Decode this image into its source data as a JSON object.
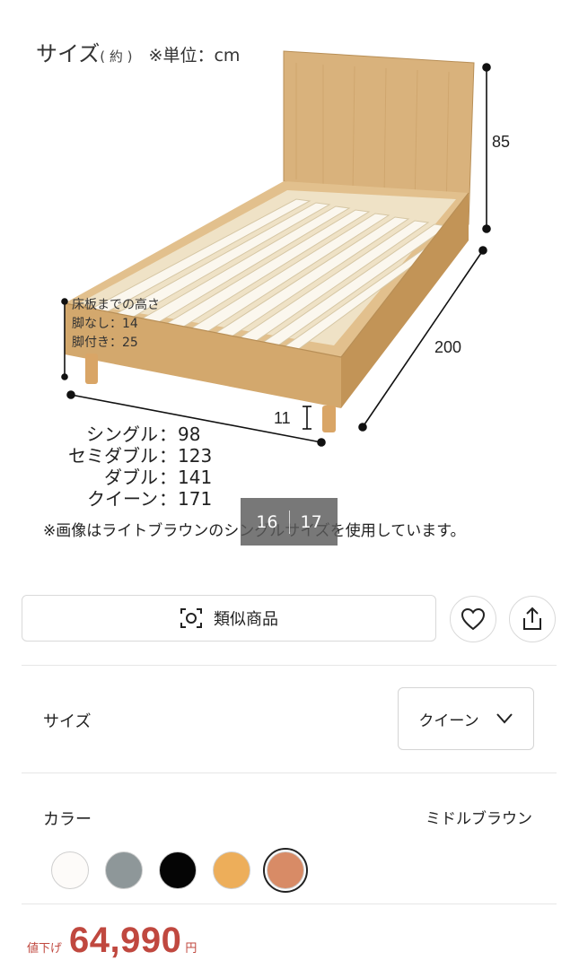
{
  "image": {
    "size_title": "サイズ",
    "size_title_approx": "( 約 )",
    "unit_note": "※単位：cm",
    "dimensions": {
      "headboard_height": "85",
      "length": "200",
      "leg_height": "11"
    },
    "height_note": {
      "title": "床板までの高さ",
      "no_legs": "脚なし：14",
      "with_legs": "脚付き：25"
    },
    "widths": [
      {
        "name": "シングル",
        "value": "98"
      },
      {
        "name": "セミダブル",
        "value": "123"
      },
      {
        "name": "ダブル",
        "value": "141"
      },
      {
        "name": "クイーン",
        "value": "171"
      }
    ],
    "note": "※画像はライトブラウンのシングルサイズを使用しています。",
    "counter_current": "16",
    "counter_total": "17"
  },
  "actions": {
    "similar_label": "類似商品",
    "similar_icon": "scan-icon",
    "favorite_icon": "heart-icon",
    "share_icon": "share-icon"
  },
  "size": {
    "label": "サイズ",
    "selected": "クイーン"
  },
  "color": {
    "label": "カラー",
    "selected": "ミドルブラウン",
    "swatches": [
      {
        "color": "#fdfbf9"
      },
      {
        "color": "#8e9799"
      },
      {
        "color": "#050505"
      },
      {
        "color": "#edae5a"
      },
      {
        "color": "#d88b66",
        "selected": true
      }
    ]
  },
  "price": {
    "tag": "値下げ",
    "value": "64,990",
    "unit": "円"
  }
}
